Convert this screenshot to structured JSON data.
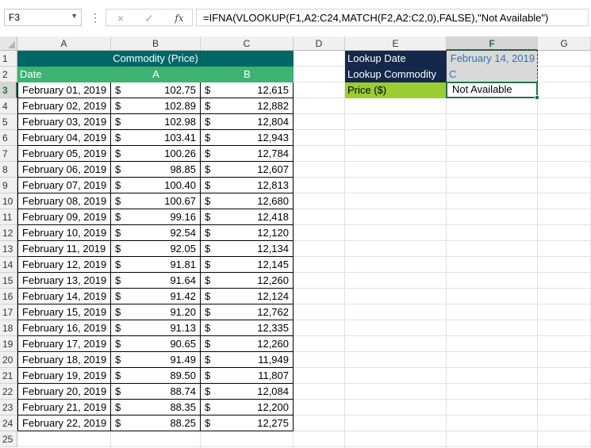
{
  "formula_bar": {
    "name_box": "F3",
    "formula": "=IFNA(VLOOKUP(F1,A2:C24,MATCH(F2,A2:C2,0),FALSE),\"Not Available\")",
    "cancel_icon": "×",
    "enter_icon": "✓",
    "fx_label": "fx"
  },
  "columns": [
    "A",
    "B",
    "C",
    "D",
    "E",
    "F",
    "G"
  ],
  "rows": [
    "1",
    "2",
    "3",
    "4",
    "5",
    "6",
    "7",
    "8",
    "9",
    "10",
    "11",
    "12",
    "13",
    "14",
    "15",
    "16",
    "17",
    "18",
    "19",
    "20",
    "21",
    "22",
    "23",
    "24",
    "25"
  ],
  "table": {
    "title": "Commodity (Price)",
    "headers": [
      "Date",
      "A",
      "B"
    ],
    "currency": "$",
    "data": [
      [
        "February 01, 2019",
        "102.75",
        "12,615"
      ],
      [
        "February 02, 2019",
        "102.89",
        "12,882"
      ],
      [
        "February 03, 2019",
        "102.98",
        "12,804"
      ],
      [
        "February 04, 2019",
        "103.41",
        "12,943"
      ],
      [
        "February 05, 2019",
        "100.26",
        "12,784"
      ],
      [
        "February 06, 2019",
        "98.85",
        "12,607"
      ],
      [
        "February 07, 2019",
        "100.40",
        "12,813"
      ],
      [
        "February 08, 2019",
        "100.67",
        "12,680"
      ],
      [
        "February 09, 2019",
        "99.16",
        "12,418"
      ],
      [
        "February 10, 2019",
        "92.54",
        "12,120"
      ],
      [
        "February 11, 2019",
        "92.05",
        "12,134"
      ],
      [
        "February 12, 2019",
        "91.81",
        "12,145"
      ],
      [
        "February 13, 2019",
        "91.64",
        "12,260"
      ],
      [
        "February 14, 2019",
        "91.42",
        "12,124"
      ],
      [
        "February 15, 2019",
        "91.20",
        "12,762"
      ],
      [
        "February 16, 2019",
        "91.13",
        "12,335"
      ],
      [
        "February 17, 2019",
        "90.65",
        "12,260"
      ],
      [
        "February 18, 2019",
        "91.49",
        "11,949"
      ],
      [
        "February 19, 2019",
        "89.50",
        "11,807"
      ],
      [
        "February 20, 2019",
        "88.74",
        "12,084"
      ],
      [
        "February 21, 2019",
        "88.35",
        "12,200"
      ],
      [
        "February 22, 2019",
        "88.25",
        "12,275"
      ]
    ]
  },
  "lookup": {
    "date_label": "Lookup Date",
    "date_value": "February 14, 2019",
    "commodity_label": "Lookup Commodity",
    "commodity_value": "C",
    "price_label": "Price ($)",
    "price_value": "Not Available"
  },
  "colors": {
    "title_bg": "#006666",
    "header_bg": "#3cb371",
    "lookup_label_bg": "#14284b",
    "price_label_bg": "#9acd32",
    "selection": "#217346"
  }
}
